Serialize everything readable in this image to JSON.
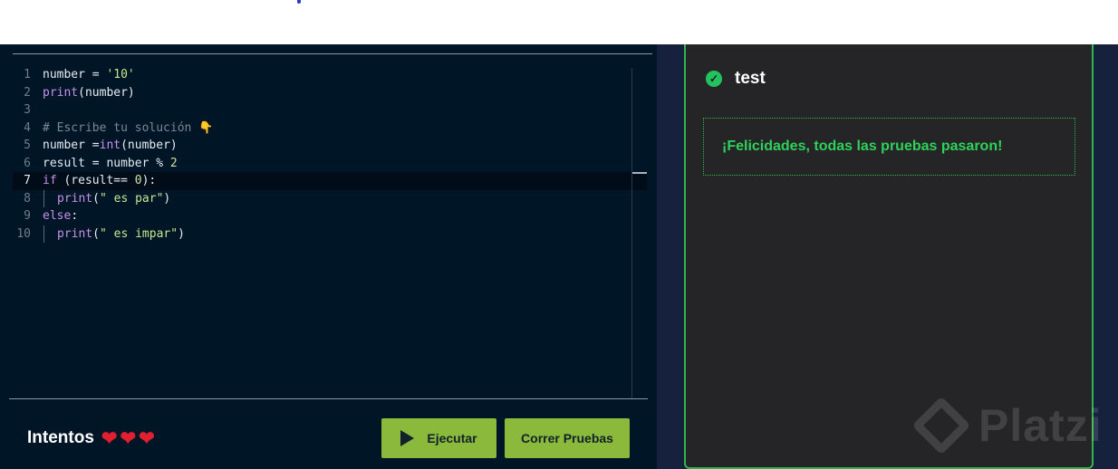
{
  "editor": {
    "lines": [
      {
        "n": "1",
        "parts": [
          [
            "op",
            "number = "
          ],
          [
            "str",
            "'10'"
          ]
        ]
      },
      {
        "n": "2",
        "parts": [
          [
            "fn",
            "print"
          ],
          [
            "op",
            "(number)"
          ]
        ]
      },
      {
        "n": "3",
        "parts": []
      },
      {
        "n": "4",
        "parts": [
          [
            "cm",
            "# Escribe tu solución 👇"
          ]
        ]
      },
      {
        "n": "5",
        "parts": [
          [
            "op",
            "number ="
          ],
          [
            "fn",
            "int"
          ],
          [
            "op",
            "(number)"
          ]
        ]
      },
      {
        "n": "6",
        "parts": [
          [
            "op",
            "result = number % "
          ],
          [
            "num",
            "2"
          ]
        ]
      },
      {
        "n": "7",
        "parts": [
          [
            "kw",
            "if"
          ],
          [
            "op",
            " (result== "
          ],
          [
            "num",
            "0"
          ],
          [
            "op",
            "):"
          ]
        ],
        "active": true
      },
      {
        "n": "8",
        "parts": [
          [
            "fn",
            "print"
          ],
          [
            "op",
            "("
          ],
          [
            "str",
            "\" es par\""
          ],
          [
            "op",
            ")"
          ]
        ],
        "indent": true
      },
      {
        "n": "9",
        "parts": [
          [
            "kw",
            "else"
          ],
          [
            "op",
            ":"
          ]
        ]
      },
      {
        "n": "10",
        "parts": [
          [
            "fn",
            "print"
          ],
          [
            "op",
            "("
          ],
          [
            "str",
            "\" es impar\""
          ],
          [
            "op",
            ")"
          ]
        ],
        "indent": true
      }
    ]
  },
  "footer": {
    "attempts_label": "Intentos",
    "hearts_remaining": 3,
    "run_label": "Ejecutar",
    "tests_label": "Correr Pruebas"
  },
  "results": {
    "test_name": "test",
    "success_message": "¡Felicidades, todas las pruebas pasaron!",
    "watermark": "Platzi"
  },
  "colors": {
    "button_green": "#8ab93b",
    "success_green": "#2fd15a",
    "editor_bg": "#001526",
    "results_bg": "#252527"
  }
}
